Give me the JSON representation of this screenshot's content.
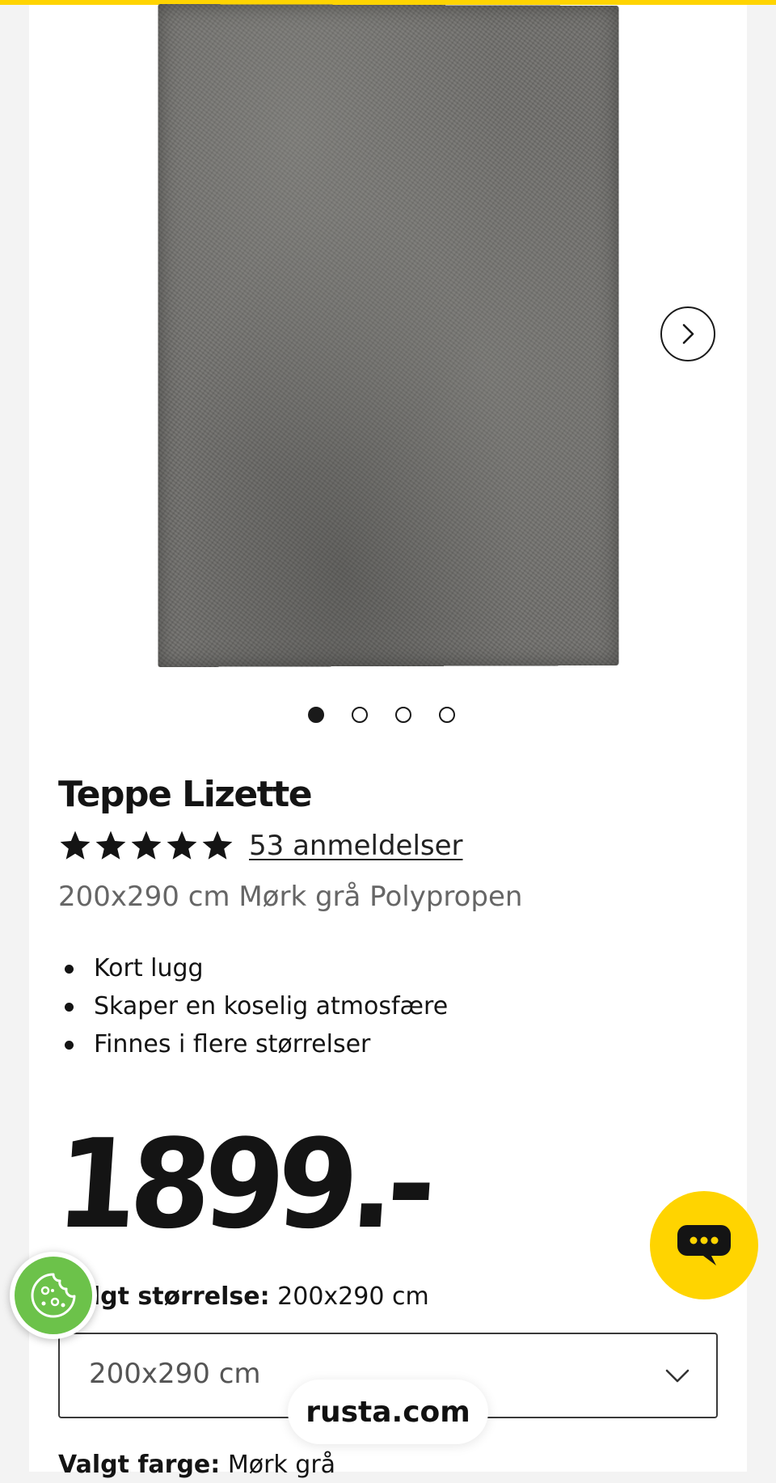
{
  "product": {
    "title": "Teppe Lizette",
    "rating_stars": 5,
    "reviews_label": "53 anmeldelser",
    "subtitle": "200x290 cm Mørk grå Polypropen",
    "features": [
      "Kort lugg",
      "Skaper en koselig atmosfære",
      "Finnes i flere størrelser"
    ],
    "price": "1899.-"
  },
  "gallery": {
    "image_count": 4,
    "active_index": 0,
    "image_icon": "rug-photo",
    "next_icon": "chevron-right-icon"
  },
  "size_selector": {
    "label_key": "Valgt størrelse:",
    "label_value": "200x290 cm",
    "selected": "200x290 cm"
  },
  "color_selector": {
    "label_key": "Valgt farge:",
    "label_value": "Mørk grå"
  },
  "overlays": {
    "domain": "rusta.com",
    "chat_icon": "chat-bubble-icon",
    "cookie_icon": "cookie-icon"
  },
  "colors": {
    "accent": "#ffd400",
    "cookie_green": "#6cc24a",
    "text": "#141414",
    "muted": "#666666"
  }
}
